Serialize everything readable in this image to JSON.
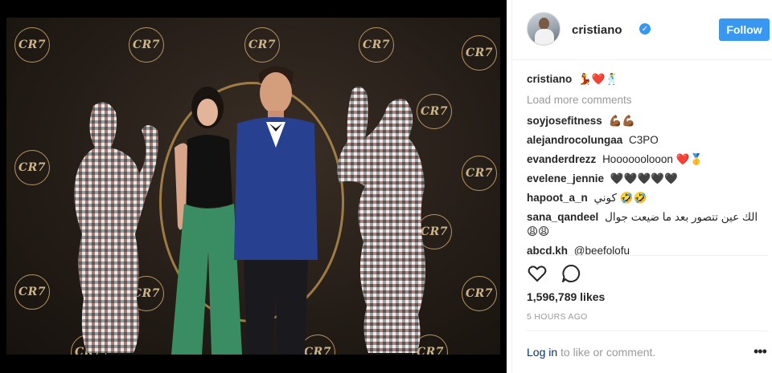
{
  "photo": {
    "logo_text": "CR7",
    "alt": ""
  },
  "header": {
    "username": "cristiano",
    "verified_glyph": "✓",
    "follow_label": "Follow"
  },
  "caption": {
    "user": "cristiano",
    "text": "💃❤️🕺"
  },
  "load_more_label": "Load more comments",
  "comments": [
    {
      "user": "soyjosefitness",
      "text": "💪🏾💪🏾"
    },
    {
      "user": "alejandrocolungaa",
      "text": "C3PO"
    },
    {
      "user": "evanderdrezz",
      "text": "Hoooooolooon ❤️🥇"
    },
    {
      "user": "evelene_jennie",
      "text": "🖤🖤🖤🖤🖤"
    },
    {
      "user": "hapoot_a_n",
      "text": "كوني 🤣🤣"
    },
    {
      "user": "sana_qandeel",
      "text": "الك عين تتصور بعد ما ضيعت جوال 😩😩"
    },
    {
      "user": "abcd.kh",
      "text": "@beefolofu"
    }
  ],
  "actions": {
    "like_icon": "heart-outline-icon",
    "comment_icon": "comment-bubble-icon"
  },
  "likes": "1,596,789 likes",
  "timestamp": "5 HOURS AGO",
  "footer": {
    "login_label": "Log in",
    "login_suffix": " to like or comment.",
    "more_glyph": "•••"
  },
  "colors": {
    "accent": "#3897f0",
    "link": "#003569",
    "muted": "#999999",
    "photo_bg": "#000000"
  }
}
